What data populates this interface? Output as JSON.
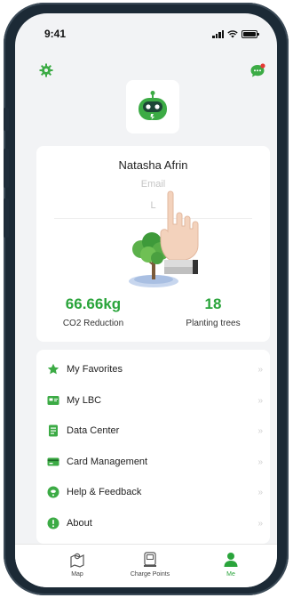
{
  "status_bar": {
    "time": "9:41"
  },
  "profile": {
    "name": "Natasha Afrin",
    "email_label": "Email",
    "login_partial": "L"
  },
  "stats": [
    {
      "value": "66.66kg",
      "label": "CO2 Reduction"
    },
    {
      "value": "18",
      "label": "Planting trees"
    }
  ],
  "menu": {
    "items": [
      {
        "label": "My Favorites",
        "icon": "star-icon",
        "color": "#3cab45"
      },
      {
        "label": "My LBC",
        "icon": "card-icon",
        "color": "#3cab45"
      },
      {
        "label": "Data Center",
        "icon": "document-icon",
        "color": "#3cab45"
      },
      {
        "label": "Card Management",
        "icon": "wallet-icon",
        "color": "#3cab45"
      },
      {
        "label": "Help & Feedback",
        "icon": "help-icon",
        "color": "#3cab45"
      },
      {
        "label": "About",
        "icon": "info-icon",
        "color": "#3cab45"
      }
    ],
    "chevron": "»"
  },
  "tabs": [
    {
      "label": "Map",
      "icon": "map-icon",
      "active": false
    },
    {
      "label": "Charge Points",
      "icon": "charger-icon",
      "active": false
    },
    {
      "label": "Me",
      "icon": "person-icon",
      "active": true
    }
  ],
  "colors": {
    "accent": "#2aa43b",
    "background": "#f2f3f5",
    "frame": "#1c2a36"
  }
}
